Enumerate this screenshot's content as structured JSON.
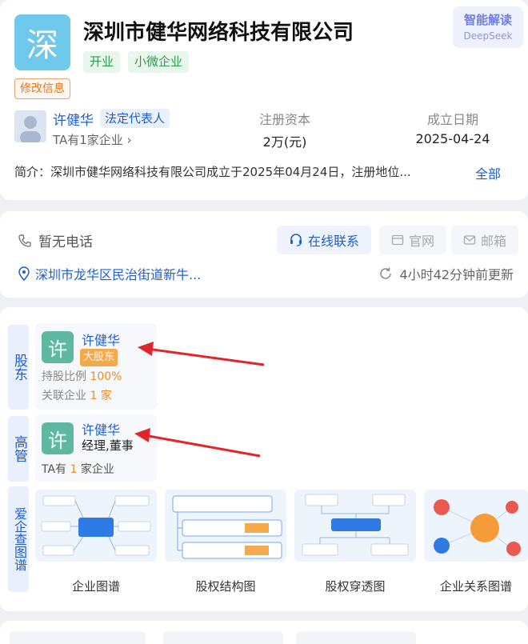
{
  "header": {
    "logo_char": "深",
    "company_name": "深圳市健华网络科技有限公司",
    "tags": [
      "开业",
      "小微企业"
    ],
    "edit_tag": "修改信息",
    "ai_button": {
      "title": "智能解读",
      "subtitle": "DeepSeek"
    },
    "legal_rep": {
      "name": "许健华",
      "role": "法定代表人",
      "enterprises": "TA有1家企业"
    },
    "registered_capital": {
      "label": "注册资本",
      "value": "2万(元)"
    },
    "established": {
      "label": "成立日期",
      "value": "2025-04-24"
    },
    "intro": {
      "label": "简介：",
      "text": "深圳市健华网络科技有限公司成立于2025年04月24日，注册地位...",
      "more": "全部"
    }
  },
  "contact": {
    "phone": "暂无电话",
    "online_contact": "在线联系",
    "website": "官网",
    "email": "邮箱",
    "address": "深圳市龙华区民治街道新牛...",
    "updated": "4小时42分钟前更新"
  },
  "shareholders": {
    "section_label": "股东",
    "person": {
      "avatar_char": "许",
      "name": "许健华",
      "badge": "大股东",
      "share_label": "持股比例",
      "share_value": "100%",
      "related_label": "关联企业",
      "related_value": "1",
      "related_unit": "家"
    }
  },
  "executives": {
    "section_label": "高管",
    "person": {
      "avatar_char": "许",
      "name": "许健华",
      "role": "经理,董事",
      "ent_prefix": "TA有",
      "ent_value": "1",
      "ent_suffix": "家企业"
    }
  },
  "graphs": {
    "section_label": "爱企查图谱",
    "items": [
      {
        "label": "企业图谱"
      },
      {
        "label": "股权结构图"
      },
      {
        "label": "股权穿透图"
      },
      {
        "label": "企业关系图谱"
      }
    ]
  },
  "colors": {
    "primary_blue": "#1f5fcc",
    "green_tag": "#2d9b51",
    "orange": "#f08a24",
    "arrow_red": "#e0262b"
  }
}
